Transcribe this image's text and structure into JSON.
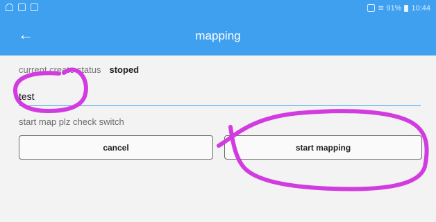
{
  "status_bar": {
    "left_icons": [
      "wifi-icon",
      "cast-icon",
      "image-icon"
    ],
    "signal_text": "≋ 91%",
    "time": "10:44"
  },
  "app_bar": {
    "back_icon": "arrow-left-icon",
    "title": "mapping"
  },
  "create_status": {
    "label": "current create status",
    "value": "stoped"
  },
  "map_name_input": {
    "value": "test"
  },
  "hint": "start map plz check switch",
  "buttons": {
    "cancel": "cancel",
    "start": "start mapping"
  },
  "annotation_color": "#d23be0"
}
